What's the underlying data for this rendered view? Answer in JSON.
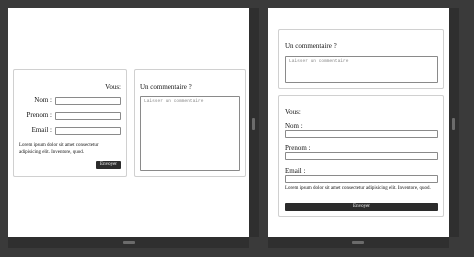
{
  "left_view": {
    "form": {
      "heading": "Vous:",
      "nom_label": "Nom :",
      "prenom_label": "Prenom :",
      "email_label": "Email :",
      "nom_value": "",
      "prenom_value": "",
      "email_value": "",
      "lorem": "Lorem ipsum dolor sit amet consectetur adipisicing elit. Inventore, quod.",
      "submit_label": "Envoyer"
    },
    "comment": {
      "heading": "Un commentaire ?",
      "placeholder": "Laisser un commentaire"
    }
  },
  "right_view": {
    "comment": {
      "heading": "Un commentaire ?",
      "placeholder": "Laisser un commentaire"
    },
    "form": {
      "heading": "Vous:",
      "nom_label": "Nom :",
      "prenom_label": "Prenom :",
      "email_label": "Email :",
      "nom_value": "",
      "prenom_value": "",
      "email_value": "",
      "lorem": "Lorem ipsum dolor sit amet consectetur adipisicing elit. Inventore, quod.",
      "submit_label": "Envoyer"
    }
  }
}
